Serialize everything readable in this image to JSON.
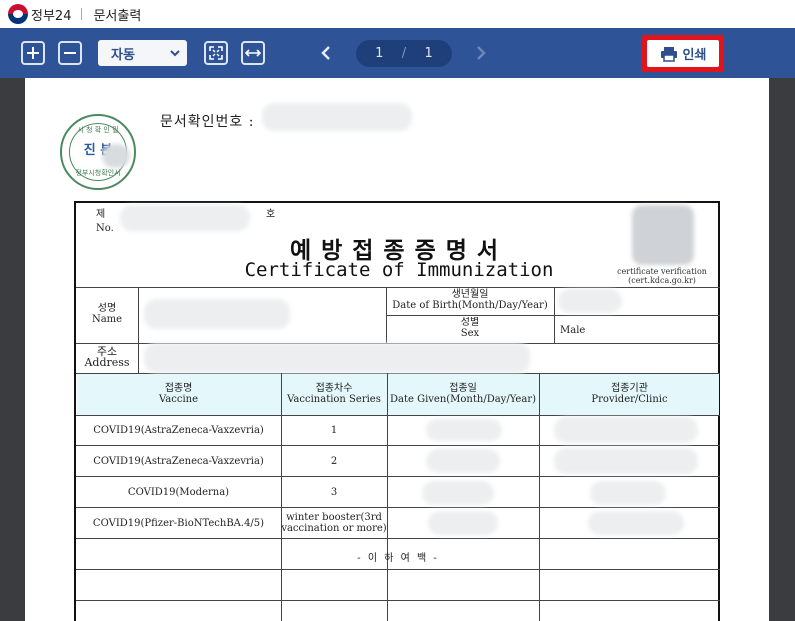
{
  "app": {
    "logo_icon": "gov-taegeuk-logo",
    "site_name": "정부24",
    "page_title": "문서출력"
  },
  "toolbar": {
    "zoom_in_icon": "plus-box-icon",
    "zoom_out_icon": "minus-box-icon",
    "zoom_select_value": "자동",
    "fit_page_icon": "fit-page-icon",
    "fit_width_icon": "fit-width-icon",
    "current_page": "1",
    "page_sep": "/",
    "total_pages": "1",
    "print_label": "인쇄",
    "print_highlight_color": "#e1141e",
    "toolbar_color": "#2e5497"
  },
  "document": {
    "seal": {
      "top_text": "시 청 확 인 필",
      "center_text": "진 본",
      "bottom_text": "정부시청확인서"
    },
    "doc_check_label": "문서확인번호 :",
    "cert_no_label_ko": "제",
    "cert_no_label_en": "No.",
    "cert_no_suffix": "호",
    "title_ko": "예방접종증명서",
    "title_en": "Certificate of Immunization",
    "verify_line1": "certificate verification",
    "verify_line2": "(cert.kdca.go.kr)",
    "name_ko": "성명",
    "name_en": "Name",
    "dob_ko": "생년월일",
    "dob_en": "Date of Birth(Month/Day/Year)",
    "sex_ko": "성별",
    "sex_en": "Sex",
    "sex_value": "Male",
    "address_ko": "주소",
    "address_en": "Address",
    "columns": [
      {
        "ko": "접종명",
        "en": "Vaccine"
      },
      {
        "ko": "접종차수",
        "en": "Vaccination Series"
      },
      {
        "ko": "접종일",
        "en": "Date Given(Month/Day/Year)"
      },
      {
        "ko": "접종기관",
        "en": "Provider/Clinic"
      }
    ],
    "rows": [
      {
        "vaccine": "COVID19(AstraZeneca-Vaxzevria)",
        "series": "1"
      },
      {
        "vaccine": "COVID19(AstraZeneca-Vaxzevria)",
        "series": "2"
      },
      {
        "vaccine": "COVID19(Moderna)",
        "series": "3"
      },
      {
        "vaccine": "COVID19(Pfizer-BioNTechBA.4/5)",
        "series_line1": "winter booster(3rd",
        "series_line2": "vaccination or more)"
      }
    ],
    "end_mark": "-  이  하  여  백  -"
  }
}
